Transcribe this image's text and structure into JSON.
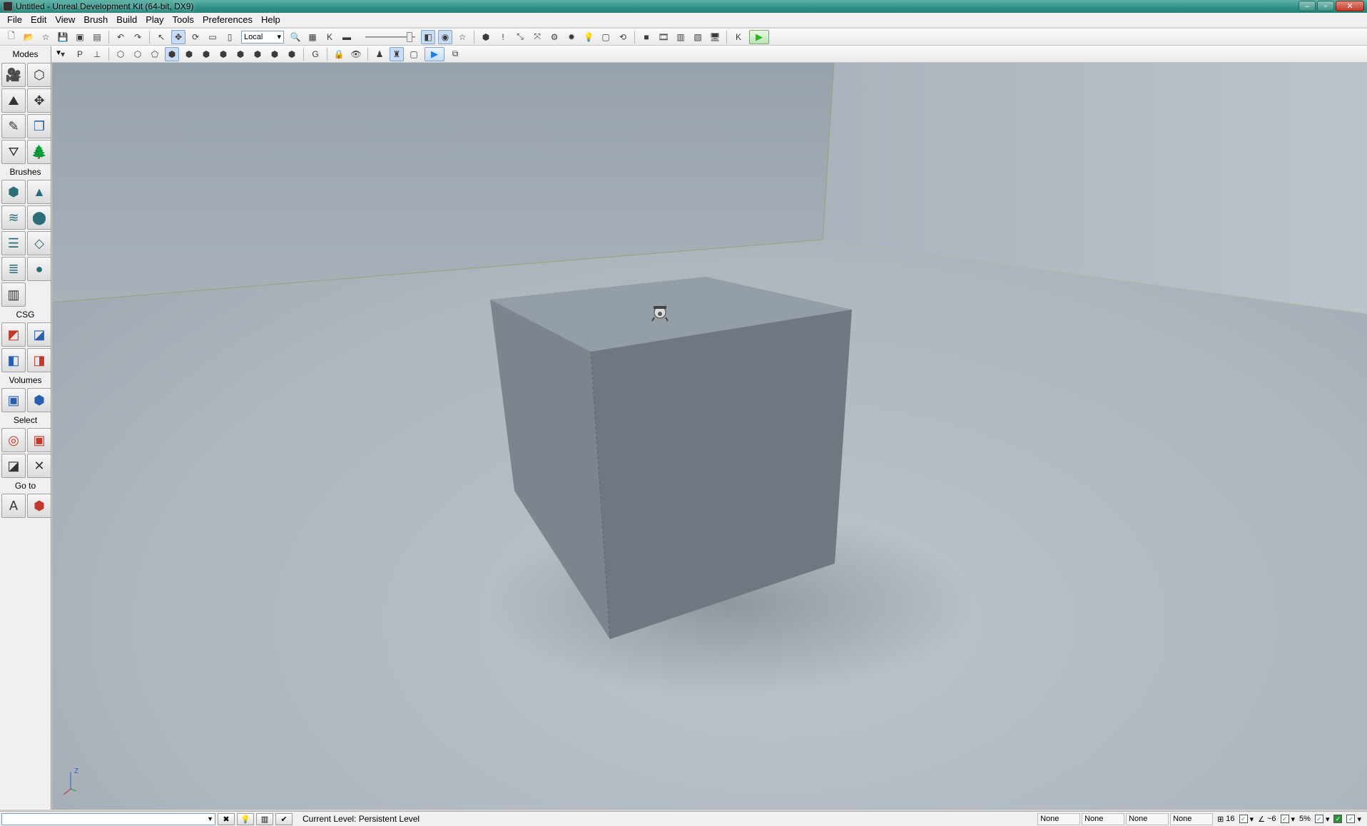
{
  "window": {
    "title": "Untitled - Unreal Development Kit (64-bit, DX9)",
    "controls": {
      "minimize": "–",
      "maximize": "▫",
      "close": "✕"
    }
  },
  "menu": [
    "File",
    "Edit",
    "View",
    "Brush",
    "Build",
    "Play",
    "Tools",
    "Preferences",
    "Help"
  ],
  "toolbar": {
    "coordinate_system": "Local",
    "icons": [
      "new-icon",
      "open-icon",
      "favorite-icon",
      "save-icon",
      "save-all-icon",
      "save-as-icon",
      "undo-icon",
      "redo-icon",
      "select-icon",
      "translate-icon",
      "rotate-icon",
      "scale-icon",
      "nonuniform-scale-icon"
    ]
  },
  "modes_panel": {
    "title": "Modes",
    "sections": {
      "brushes": "Brushes",
      "csg": "CSG",
      "volumes": "Volumes",
      "select": "Select",
      "goto": "Go to"
    }
  },
  "status": {
    "current_level_label": "Current Level:",
    "current_level_value": "Persistent Level",
    "fields": [
      "None",
      "None",
      "None",
      "None"
    ],
    "grid_size": "16",
    "rotation_snap": "~6",
    "scale_snap": "5%"
  },
  "viewport": {
    "axis": {
      "z": "Z"
    },
    "colors": {
      "floor": "#a9b3bc",
      "wall": "#b9c2ca",
      "cube_top": "#949ea7",
      "cube_left": "#7c858e",
      "cube_right": "#6f7881"
    }
  }
}
